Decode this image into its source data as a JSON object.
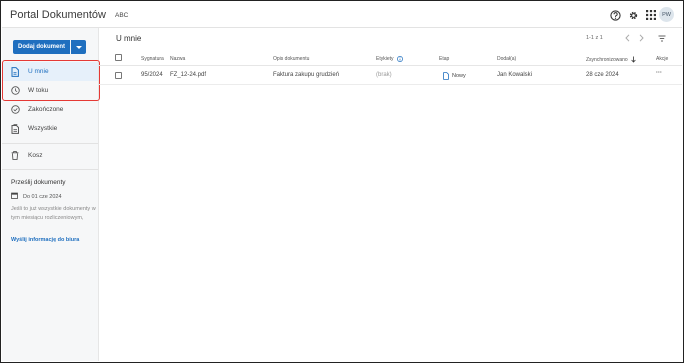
{
  "header": {
    "app_title": "Portal Dokumentów",
    "tenant": "ABC",
    "avatar_initials": "PW",
    "icons": [
      "help-icon",
      "settings-icon",
      "apps-grid-icon"
    ]
  },
  "sidebar": {
    "add_button_label": "Dodaj dokument",
    "items": [
      {
        "label": "U mnie",
        "icon": "document-icon",
        "active": true
      },
      {
        "label": "W toku",
        "icon": "clock-icon"
      },
      {
        "label": "Zakończone",
        "icon": "check-circle-icon"
      },
      {
        "label": "Wszystkie",
        "icon": "documents-icon"
      },
      {
        "label": "Kosz",
        "icon": "trash-icon"
      }
    ],
    "upload": {
      "title": "Prześlij dokumenty",
      "deadline": "Do 01 cze 2024",
      "note": "Jeśli to już wszystkie dokumenty w tym miesiącu rozliczeniowym,",
      "link": "Wyślij informację do biura"
    }
  },
  "main": {
    "title": "U mnie",
    "pager": "1-1 z 1",
    "columns": {
      "signature": "Sygnatura",
      "name": "Nazwa",
      "description": "Opis dokumentu",
      "labels": "Etykiety",
      "stage": "Etap",
      "added_by": "Dodał(a)",
      "synced": "Zsynchronizowano",
      "actions": "Akcje"
    },
    "rows": [
      {
        "signature": "95/2024",
        "name": "FZ_12-24.pdf",
        "description": "Faktura zakupu grudzień",
        "labels": "(brak)",
        "stage": "Nowy",
        "added_by": "Jan Kowalski",
        "synced": "28 cze 2024",
        "actions": "···"
      }
    ]
  },
  "colors": {
    "accent": "#1f6fbf",
    "highlight": "#e53935",
    "active_bg": "#e6f0fa"
  }
}
